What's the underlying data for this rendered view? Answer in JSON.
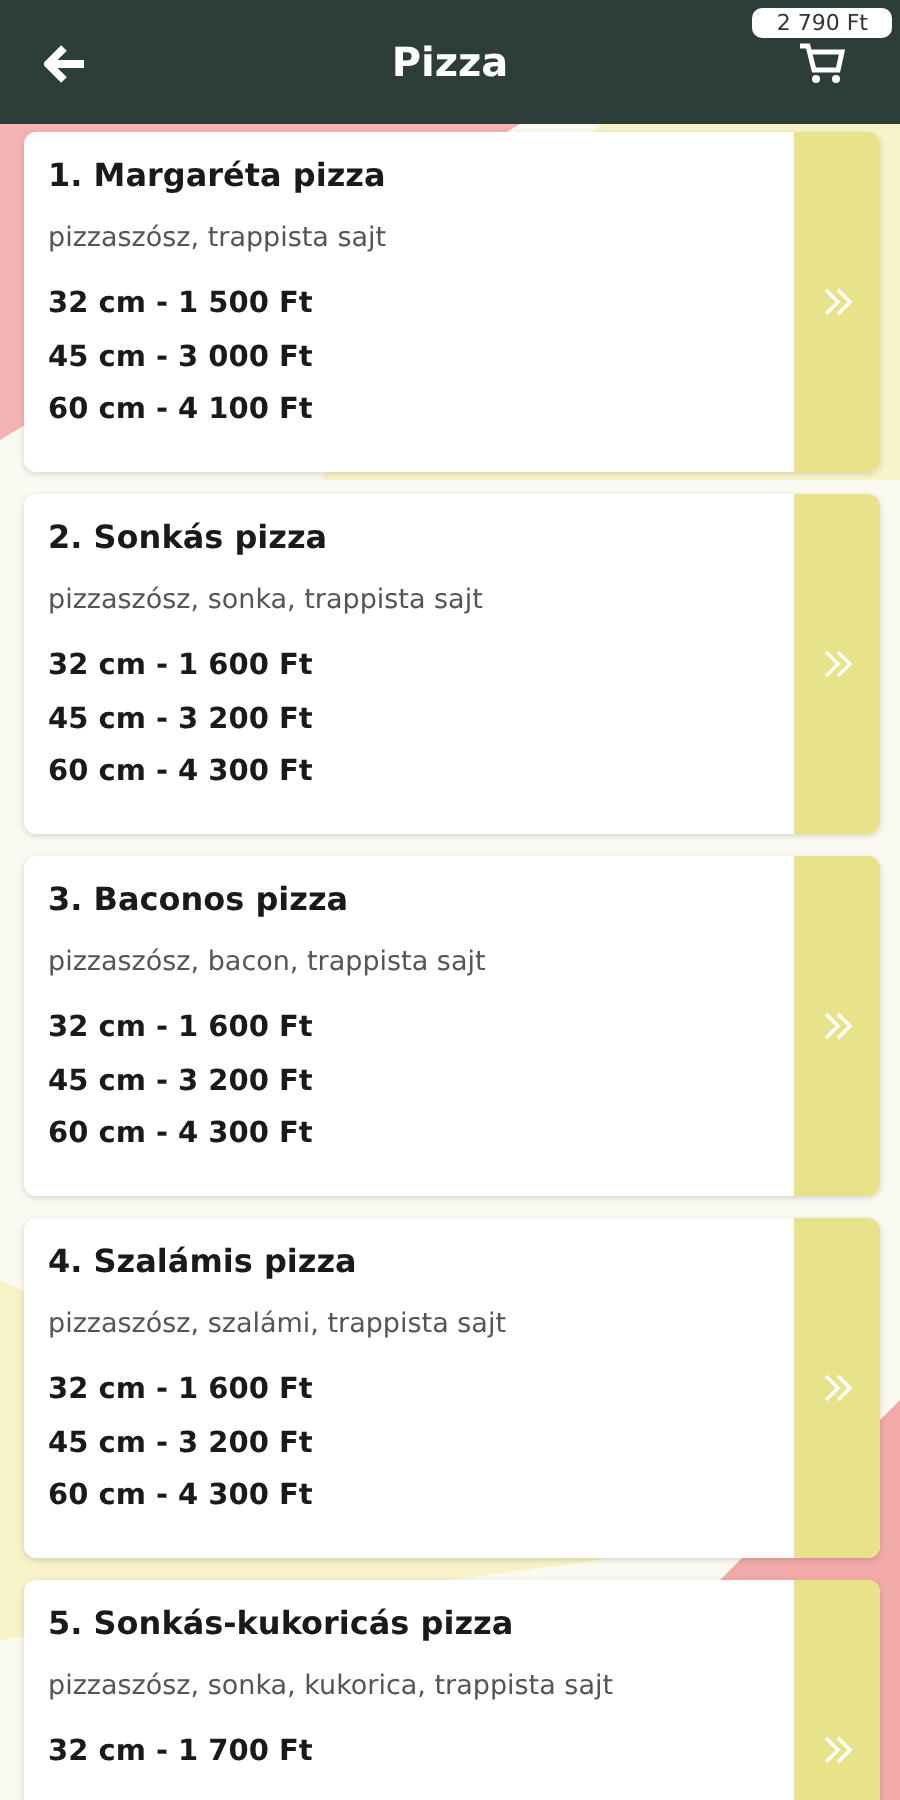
{
  "header": {
    "title": "Pizza",
    "cart_total": "2 790 Ft"
  },
  "pizzas": [
    {
      "name": "1. Margaréta pizza",
      "ingredients": "pizzaszósz, trappista sajt",
      "prices": [
        "32 cm - 1 500 Ft",
        "45 cm - 3 000 Ft",
        "60 cm - 4 100 Ft"
      ]
    },
    {
      "name": "2. Sonkás pizza",
      "ingredients": "pizzaszósz, sonka, trappista sajt",
      "prices": [
        "32 cm - 1 600 Ft",
        "45 cm - 3 200 Ft",
        "60 cm - 4 300 Ft"
      ]
    },
    {
      "name": "3. Baconos pizza",
      "ingredients": "pizzaszósz, bacon, trappista sajt",
      "prices": [
        "32 cm - 1 600 Ft",
        "45 cm - 3 200 Ft",
        "60 cm - 4 300 Ft"
      ]
    },
    {
      "name": "4. Szalámis pizza",
      "ingredients": "pizzaszósz, szalámi, trappista sajt",
      "prices": [
        "32 cm - 1 600 Ft",
        "45 cm - 3 200 Ft",
        "60 cm - 4 300 Ft"
      ]
    },
    {
      "name": "5. Sonkás-kukoricás pizza",
      "ingredients": "pizzaszósz, sonka, kukorica, trappista sajt",
      "prices": [
        "32 cm - 1 700 Ft"
      ]
    }
  ]
}
